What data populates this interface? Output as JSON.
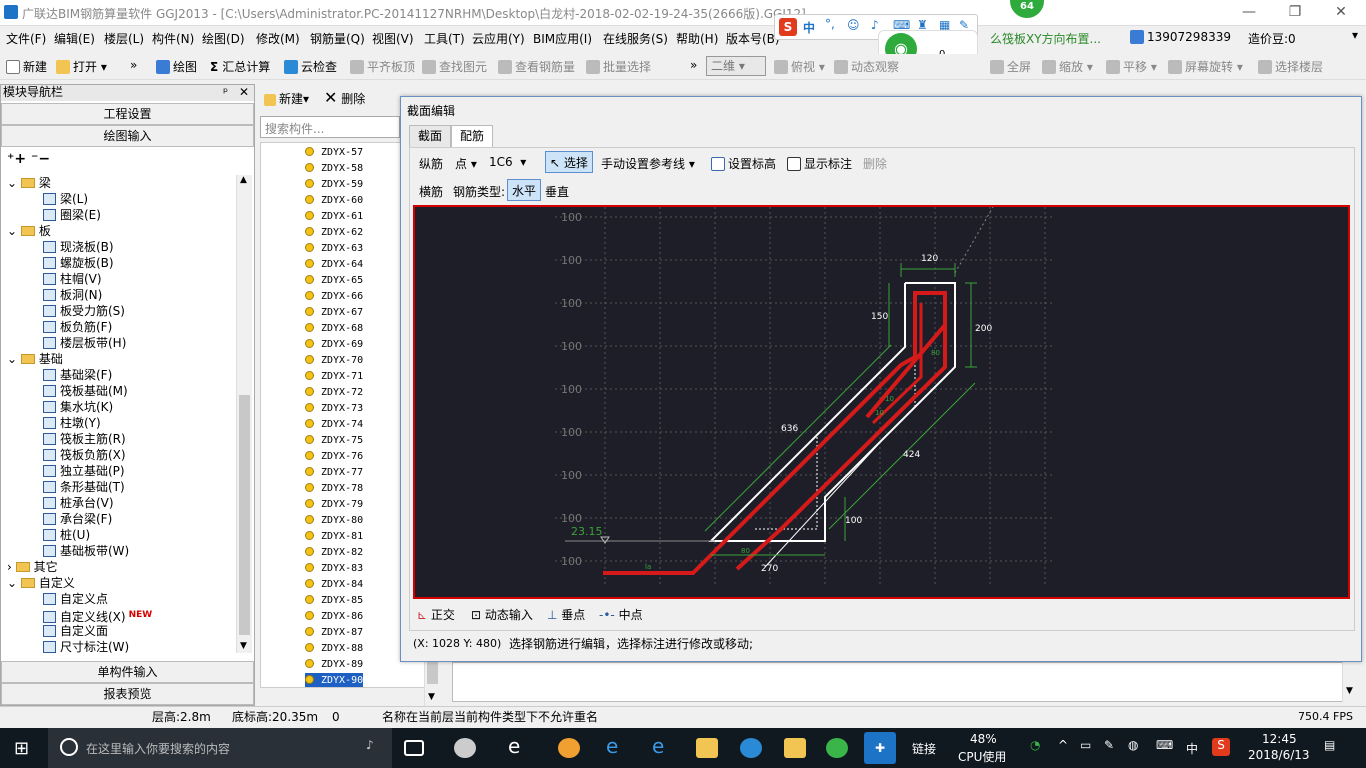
{
  "window": {
    "title": "广联达BIM钢筋算量软件 GGJ2013 - [C:\\Users\\Administrator.PC-20141127NRHM\\Desktop\\白龙村-2018-02-02-19-24-35(2666版).GGJ12]",
    "badge_count": "64"
  },
  "menu": [
    "文件(F)",
    "编辑(E)",
    "楼层(L)",
    "构件(N)",
    "绘图(D)",
    "修改(M)",
    "钢筋量(Q)",
    "视图(V)",
    "工具(T)",
    "云应用(Y)",
    "BIM应用(I)",
    "在线服务(S)",
    "帮助(H)",
    "版本号(B)"
  ],
  "menu_right": {
    "notice": "么筏板XY方向布置...",
    "phone": "13907298339",
    "cost_beans": "造价豆:0"
  },
  "ime": {
    "lang": "中",
    "wifi_count": "0"
  },
  "toolbar": {
    "new": "新建",
    "open": "打开",
    "draw": "绘图",
    "sum": "汇总计算",
    "cloud_check": "云检查",
    "flush_slab": "平齐板顶",
    "find_element": "查找图元",
    "view_rebar": "查看钢筋量",
    "batch_select": "批量选择",
    "view_mode": "二维",
    "top_view": "俯视",
    "dynamic_view": "动态观察",
    "fullscreen": "全屏",
    "zoom": "缩放",
    "pan": "平移",
    "rotate": "屏幕旋转",
    "select_floor": "选择楼层"
  },
  "nav": {
    "header": "模块导航栏",
    "btn_project": "工程设置",
    "btn_draw": "绘图输入",
    "btn_single": "单构件输入",
    "btn_report": "报表预览",
    "tree": [
      {
        "type": "folder",
        "label": "梁"
      },
      {
        "type": "item",
        "label": "梁(L)"
      },
      {
        "type": "item",
        "label": "圈梁(E)"
      },
      {
        "type": "folder",
        "label": "板"
      },
      {
        "type": "item",
        "label": "现浇板(B)"
      },
      {
        "type": "item",
        "label": "螺旋板(B)"
      },
      {
        "type": "item",
        "label": "柱帽(V)"
      },
      {
        "type": "item",
        "label": "板洞(N)"
      },
      {
        "type": "item",
        "label": "板受力筋(S)"
      },
      {
        "type": "item",
        "label": "板负筋(F)"
      },
      {
        "type": "item",
        "label": "楼层板带(H)"
      },
      {
        "type": "folder",
        "label": "基础"
      },
      {
        "type": "item",
        "label": "基础梁(F)"
      },
      {
        "type": "item",
        "label": "筏板基础(M)"
      },
      {
        "type": "item",
        "label": "集水坑(K)"
      },
      {
        "type": "item",
        "label": "柱墩(Y)"
      },
      {
        "type": "item",
        "label": "筏板主筋(R)"
      },
      {
        "type": "item",
        "label": "筏板负筋(X)"
      },
      {
        "type": "item",
        "label": "独立基础(P)"
      },
      {
        "type": "item",
        "label": "条形基础(T)"
      },
      {
        "type": "item",
        "label": "桩承台(V)"
      },
      {
        "type": "item",
        "label": "承台梁(F)"
      },
      {
        "type": "item",
        "label": "桩(U)"
      },
      {
        "type": "item",
        "label": "基础板带(W)"
      },
      {
        "type": "folder",
        "label": "其它",
        "collapsed": true
      },
      {
        "type": "folder",
        "label": "自定义"
      },
      {
        "type": "item",
        "label": "自定义点"
      },
      {
        "type": "item",
        "label": "自定义线(X)",
        "badge": "NEW"
      },
      {
        "type": "item",
        "label": "自定义面"
      },
      {
        "type": "item",
        "label": "尺寸标注(W)"
      }
    ]
  },
  "list": {
    "new_label": "新建",
    "delete_label": "删除",
    "search_placeholder": "搜索构件...",
    "items": [
      "ZDYX-57",
      "ZDYX-58",
      "ZDYX-59",
      "ZDYX-60",
      "ZDYX-61",
      "ZDYX-62",
      "ZDYX-63",
      "ZDYX-64",
      "ZDYX-65",
      "ZDYX-66",
      "ZDYX-67",
      "ZDYX-68",
      "ZDYX-69",
      "ZDYX-70",
      "ZDYX-71",
      "ZDYX-72",
      "ZDYX-73",
      "ZDYX-74",
      "ZDYX-75",
      "ZDYX-76",
      "ZDYX-77",
      "ZDYX-78",
      "ZDYX-79",
      "ZDYX-80",
      "ZDYX-81",
      "ZDYX-82",
      "ZDYX-83",
      "ZDYX-84",
      "ZDYX-85",
      "ZDYX-86",
      "ZDYX-87",
      "ZDYX-88",
      "ZDYX-89",
      "ZDYX-90"
    ],
    "selected": "ZDYX-90"
  },
  "dialog": {
    "title": "截面编辑",
    "tabs": [
      "截面",
      "配筋"
    ],
    "row1": {
      "long_rebar": "纵筋",
      "point": "点",
      "spec": "1C6",
      "select": "选择",
      "manual_ref": "手动设置参考线",
      "set_elev": "设置标高",
      "show_dim": "显示标注",
      "delete": "删除"
    },
    "row2": {
      "trans_rebar": "横筋",
      "rebar_type": "钢筋类型:",
      "horizontal": "水平",
      "vertical": "垂直"
    },
    "bottom": {
      "ortho": "正交",
      "dyn_input": "动态输入",
      "perp": "垂点",
      "mid": "中点"
    },
    "status_coord": "(X: 1028 Y: 480)",
    "status_msg": "选择钢筋进行编辑，选择标注进行修改或移动;",
    "canvas": {
      "grid_labels": [
        "100",
        "100",
        "100",
        "100",
        "100",
        "100",
        "100",
        "100",
        "100"
      ],
      "dims": {
        "d120": "120",
        "d150": "150",
        "d200": "200",
        "d636": "636",
        "d424": "424",
        "d100": "100",
        "d270": "270"
      },
      "elev": "23.15",
      "small_labels": {
        "la": "la",
        "s1": "80",
        "s2": "10",
        "s3": "10",
        "s4": "80"
      }
    }
  },
  "status": {
    "floor_h": "层高:2.8m",
    "base_h": "底标高:20.35m",
    "zero": "0",
    "msg": "名称在当前层当前构件类型下不允许重名",
    "fps": "750.4 FPS"
  },
  "taskbar": {
    "search_placeholder": "在这里输入你要搜索的内容",
    "link": "链接",
    "cpu_pct": "48%",
    "cpu_label": "CPU使用",
    "lang": "中",
    "time": "12:45",
    "date": "2018/6/13"
  }
}
